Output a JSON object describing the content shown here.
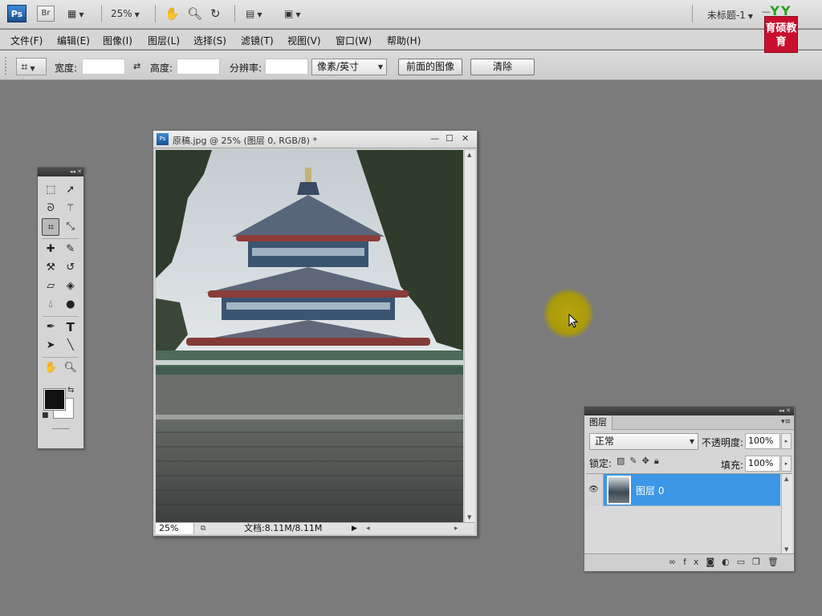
{
  "app": {
    "logo": "Ps",
    "bridge": "Br",
    "zoom": "25%",
    "doc_title": "未标题-1",
    "brand_badge": "育硕教育",
    "brand_yy": "YY"
  },
  "menu": [
    "文件(F)",
    "编辑(E)",
    "图像(I)",
    "图层(L)",
    "选择(S)",
    "滤镜(T)",
    "视图(V)",
    "窗口(W)",
    "帮助(H)"
  ],
  "options": {
    "width_label": "宽度:",
    "height_label": "高度:",
    "resolution_label": "分辨率:",
    "unit": "像素/英寸",
    "front_image": "前面的图像",
    "clear": "清除"
  },
  "document": {
    "title": "原稿.jpg @ 25% (图层 0, RGB/8) *",
    "zoom": "25%",
    "size": "文档:8.11M/8.11M"
  },
  "layers": {
    "tab": "图层",
    "blend": "正常",
    "opacity_label": "不透明度:",
    "opacity": "100%",
    "lock_label": "锁定:",
    "fill_label": "填充:",
    "fill": "100%",
    "layer_name": "图层 0"
  },
  "colors": {
    "foreground": "#111111",
    "background": "#ffffff",
    "selection": "#3d96e6"
  },
  "icons": [
    "hand-icon",
    "zoom-icon",
    "rotate-view-icon",
    "arrange-icon",
    "screen-mode-icon",
    "crop-icon",
    "eye-icon"
  ]
}
